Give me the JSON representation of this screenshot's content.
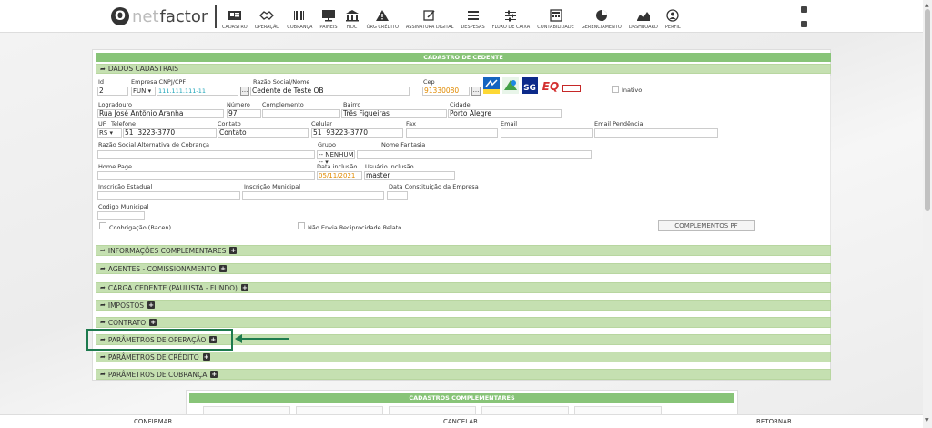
{
  "brand": {
    "o": "O",
    "net": "net",
    "factor": "factor"
  },
  "nav": [
    {
      "label": "CADASTRO",
      "icon": "id-card-icon"
    },
    {
      "label": "OPERAÇÃO",
      "icon": "handshake-icon"
    },
    {
      "label": "COBRANÇA",
      "icon": "barcode-icon"
    },
    {
      "label": "PAINEIS",
      "icon": "monitor-icon"
    },
    {
      "label": "FIDC",
      "icon": "bank-icon"
    },
    {
      "label": "ÓRG CRÉDITO",
      "icon": "warning-icon"
    },
    {
      "label": "ASSINATURA DIGITAL",
      "icon": "signature-icon"
    },
    {
      "label": "DESPESAS",
      "icon": "list-icon"
    },
    {
      "label": "FLUXO DE CAIXA",
      "icon": "sliders-icon"
    },
    {
      "label": "CONTABILIDADE",
      "icon": "calculator-icon"
    },
    {
      "label": "GERENCIAMENTO",
      "icon": "pie-chart-icon"
    },
    {
      "label": "DASHBOARD",
      "icon": "area-chart-icon"
    },
    {
      "label": "PERFIL",
      "icon": "user-icon"
    }
  ],
  "form": {
    "title": "CADASTRO DE CEDENTE",
    "section": "DADOS CADASTRAIS",
    "labels": {
      "id": "Id",
      "empresa": "Empresa CNPJ/CPF",
      "razao": "Razão Social/Nome",
      "cep": "Cep",
      "inativo": "Inativo",
      "logradouro": "Logradouro",
      "numero": "Número",
      "complemento": "Complemento",
      "bairro": "Bairro",
      "cidade": "Cidade",
      "uf": "UF",
      "telefone": "Telefone",
      "contato": "Contato",
      "celular": "Celular",
      "fax": "Fax",
      "email": "Email",
      "email_pend": "Email Pendência",
      "razao_alt": "Razão Social Alternativa de Cobrança",
      "grupo": "Grupo",
      "fantasia": "Nome Fantasia",
      "homepage": "Home Page",
      "data_inc": "Data inclusão",
      "user_inc": "Usuário inclusão",
      "insc_est": "Inscrição Estadual",
      "insc_mun": "Inscrição Municipal",
      "data_const": "Data Constituição da Empresa",
      "cod_mun": "Codigo Municipal",
      "coobrigacao": "Coobrigação (Bacen)",
      "nao_envia": "Não Envia Reciprocidade Relato"
    },
    "values": {
      "id": "2",
      "tipo": "FUN",
      "cnpj": "111.111.111-11",
      "razao": "Cedente de Teste OB",
      "cep": "91330080",
      "logradouro": "Rua José Antônio Aranha",
      "numero": "97",
      "complemento": "",
      "bairro": "Três Figueiras",
      "cidade": "Porto Alegre",
      "uf": "RS",
      "tel_ddd": "51",
      "tel": "3223-3770",
      "contato": "Contato",
      "cel_ddd": "51",
      "cel": "93223-3770",
      "grupo": "-- NENHUM --",
      "data_inc": "05/11/2021",
      "user_inc": "master"
    },
    "complementos_btn": "COMPLEMENTOS PF",
    "badges": [
      "CNEP",
      "SG",
      "EQ",
      "CONSULTA"
    ]
  },
  "sections": [
    "INFORMAÇÕES COMPLEMENTARES",
    "AGENTES - COMISSIONAMENTO",
    "CARGA CEDENTE (PAULISTA - FUNDO)",
    "IMPOSTOS",
    "CONTRATO",
    "PARÂMETROS DE OPERAÇÃO",
    "PARÂMETROS DE CRÉDITO",
    "PARÂMETROS DE COBRANÇA"
  ],
  "complementares_title": "CADASTROS COMPLEMENTARES",
  "footer": {
    "confirmar": "CONFIRMAR",
    "cancelar": "CANCELAR",
    "retornar": "RETORNAR"
  },
  "colors": {
    "bar": "#c5e0b1",
    "title": "#88c478",
    "highlight": "#1e7a4e"
  }
}
